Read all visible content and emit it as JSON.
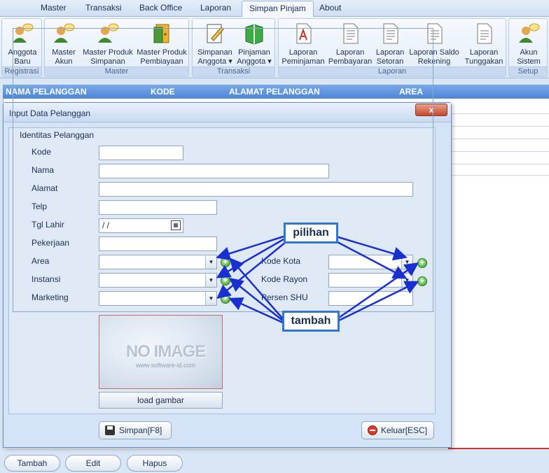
{
  "menu": {
    "items": [
      "Master",
      "Transaksi",
      "Back Office",
      "Laporan",
      "Simpan Pinjam",
      "About"
    ],
    "active": "Simpan Pinjam"
  },
  "ribbon": {
    "groups": [
      {
        "label": "Registrasi",
        "buttons": [
          {
            "line1": "Anggota",
            "line2": "Baru",
            "icon": "people-icon"
          }
        ]
      },
      {
        "label": "Master",
        "buttons": [
          {
            "line1": "Master",
            "line2": "Akun",
            "icon": "people-icon"
          },
          {
            "line1": "Master Produk",
            "line2": "Simpanan",
            "icon": "people-icon"
          },
          {
            "line1": "Master Produk",
            "line2": "Pembiayaan",
            "icon": "door-icon"
          }
        ]
      },
      {
        "label": "Transaksi",
        "buttons": [
          {
            "line1": "Simpanan",
            "line2": "Anggota ▾",
            "icon": "pencil-note-icon"
          },
          {
            "line1": "Pinjaman",
            "line2": "Anggota ▾",
            "icon": "green-book-icon"
          }
        ]
      },
      {
        "label": "Laporan",
        "buttons": [
          {
            "line1": "Laporan",
            "line2": "Peminjaman",
            "icon": "report-icon"
          },
          {
            "line1": "Laporan",
            "line2": "Pembayaran",
            "icon": "document-icon"
          },
          {
            "line1": "Laporan",
            "line2": "Setoran",
            "icon": "document-icon"
          },
          {
            "line1": "Laporan Saldo",
            "line2": "Rekening",
            "icon": "document-icon"
          },
          {
            "line1": "Laporan",
            "line2": "Tunggakan",
            "icon": "document-icon"
          }
        ]
      },
      {
        "label": "Setup",
        "buttons": [
          {
            "line1": "Akun",
            "line2": "Sistem",
            "icon": "people-icon"
          }
        ]
      }
    ]
  },
  "grid": {
    "columns": [
      "NAMA PELANGGAN",
      "KODE",
      "ALAMAT PELANGGAN",
      "AREA"
    ]
  },
  "dialog": {
    "title": "Input Data Pelanggan",
    "close_label": "x",
    "group_label": "Identitas Pelanggan",
    "fields": {
      "kode": "Kode",
      "nama": "Nama",
      "alamat": "Alamat",
      "telp": "Telp",
      "tgl_lahir": "Tgl Lahir",
      "pekerjaan": "Pekerjaan",
      "area": "Area",
      "instansi": "Instansi",
      "marketing": "Marketing",
      "kode_kota": "Kode Kota",
      "kode_rayon": "Kode Rayon",
      "persen_shu": "Persen SHU"
    },
    "tgl_lahir_value": " /  /",
    "image_placeholder": "NO IMAGE",
    "image_watermark": "www.software-id.com",
    "load_image_label": "load gambar",
    "save_label": "Simpan[F8]",
    "exit_label": "Keluar[ESC]"
  },
  "annotations": {
    "pilihan": "pilihan",
    "tambah": "tambah"
  },
  "bottom": {
    "tambah": "Tambah",
    "edit": "Edit",
    "hapus": "Hapus"
  }
}
